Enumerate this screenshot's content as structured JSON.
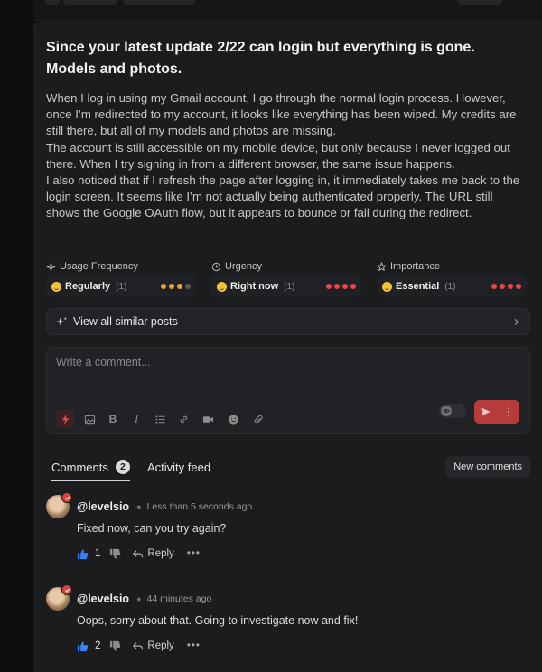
{
  "post": {
    "title": "Since your latest update 2/22 can login but everything is gone. Models and photos.",
    "body": [
      "When I log in using my Gmail account, I go through the normal login process. However, once I’m redirected to my account, it looks like everything has been wiped. My credits are still there, but all of my models and photos are missing.",
      "The account is still accessible on my mobile device, but only because I never logged out there. When I try signing in from a different browser, the same issue happens.",
      "I also noticed that if I refresh the page after logging in, it immediately takes me back to the login screen. It seems like I’m not actually being authenticated properly. The URL still shows the Google OAuth flow, but it appears to bounce or fail during the redirect."
    ]
  },
  "metrics": [
    {
      "label": "Usage Frequency",
      "icon": "sparkle-icon",
      "value": "Regularly",
      "count": "(1)",
      "level": 3,
      "max": 4,
      "color": "#e8a23a"
    },
    {
      "label": "Urgency",
      "icon": "clock-icon",
      "value": "Right now",
      "count": "(1)",
      "level": 4,
      "max": 4,
      "color": "#e5484d"
    },
    {
      "label": "Importance",
      "icon": "star-icon",
      "value": "Essential",
      "count": "(1)",
      "level": 4,
      "max": 4,
      "color": "#e5484d"
    }
  ],
  "similar": {
    "label": "View all similar posts"
  },
  "composer": {
    "placeholder": "Write a comment..."
  },
  "tabs": {
    "comments": "Comments",
    "comments_count": "2",
    "activity": "Activity feed",
    "new_comments": "New comments"
  },
  "comments": [
    {
      "author": "@levelsio",
      "time": "Less than 5 seconds ago",
      "text": "Fixed now, can you try again?",
      "likes": "1",
      "reply": "Reply"
    },
    {
      "author": "@levelsio",
      "time": "44 minutes ago",
      "text": "Oops, sorry about that. Going to investigate now and fix!",
      "likes": "2",
      "reply": "Reply"
    }
  ],
  "colors": {
    "accent": "#b83b3b",
    "like": "#3b82f6",
    "dot_off": "#5a5a5a"
  }
}
